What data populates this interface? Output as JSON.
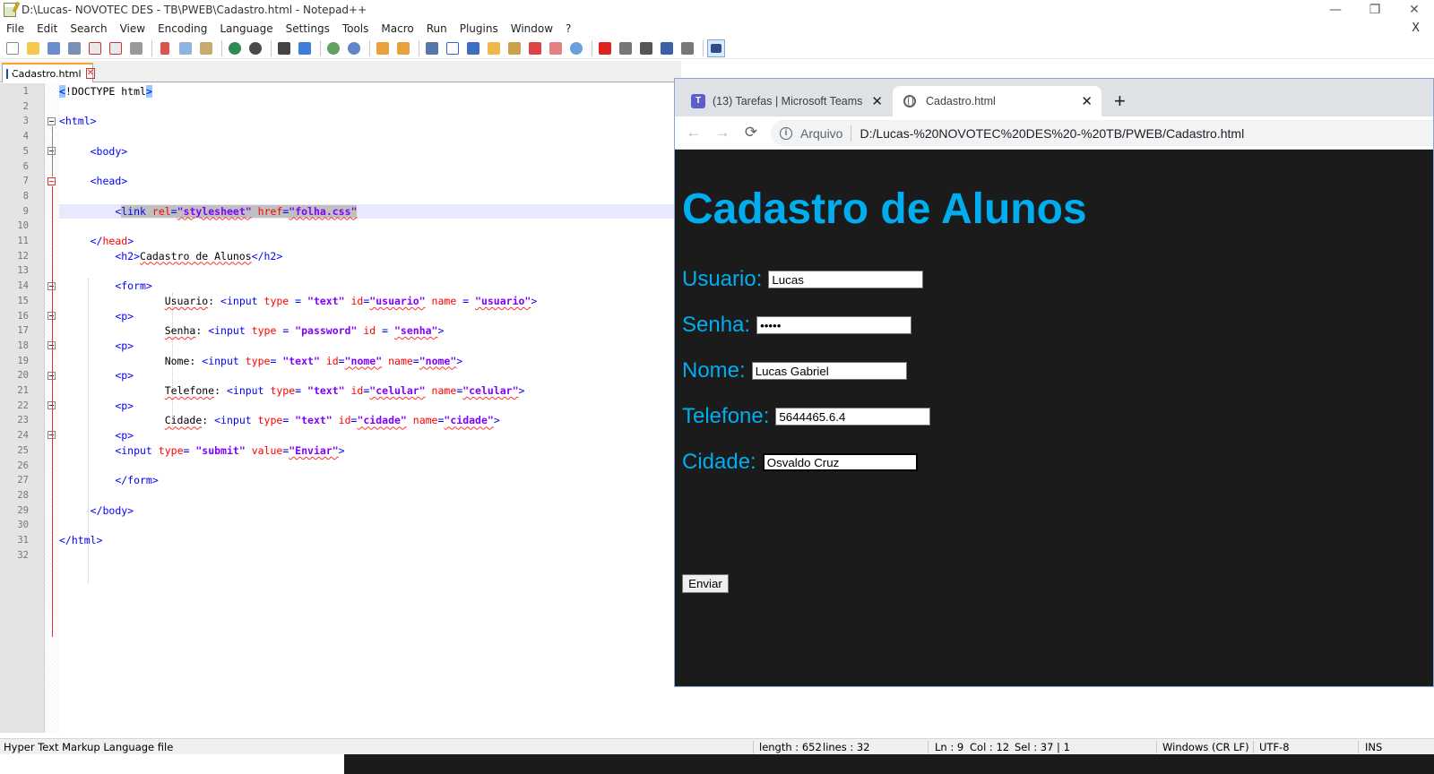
{
  "npp": {
    "title": "D:\\Lucas- NOVOTEC DES - TB\\PWEB\\Cadastro.html - Notepad++",
    "menu": [
      "File",
      "Edit",
      "Search",
      "View",
      "Encoding",
      "Language",
      "Settings",
      "Tools",
      "Macro",
      "Run",
      "Plugins",
      "Window",
      "?"
    ],
    "menu_close": "X",
    "window_controls": {
      "minimize": "—",
      "restore": "❐",
      "close": "✕"
    },
    "tab": {
      "label": "Cadastro.html",
      "close": "✕"
    },
    "line_numbers": [
      "1",
      "2",
      "3",
      "4",
      "5",
      "6",
      "7",
      "8",
      "9",
      "10",
      "11",
      "12",
      "13",
      "14",
      "15",
      "16",
      "17",
      "18",
      "19",
      "20",
      "21",
      "22",
      "23",
      "24",
      "25",
      "26",
      "27",
      "28",
      "29",
      "30",
      "31",
      "32"
    ],
    "status": {
      "file_type": "Hyper Text Markup Language file",
      "length": "length : 652",
      "lines": "lines : 32",
      "ln": "Ln : 9",
      "col": "Col : 12",
      "sel": "Sel : 37 | 1",
      "eol": "Windows (CR LF)",
      "encoding": "UTF-8",
      "mode": "INS"
    }
  },
  "browser": {
    "tabs": [
      {
        "label": "(13) Tarefas | Microsoft Teams",
        "icon": "teams-icon"
      },
      {
        "label": "Cadastro.html",
        "icon": "globe-icon"
      }
    ],
    "new_tab": "+",
    "scheme_label": "Arquivo",
    "url": "D:/Lucas-%20NOVOTEC%20DES%20-%20TB/PWEB/Cadastro.html",
    "page": {
      "heading": "Cadastro de Alunos",
      "fields": [
        {
          "label": "Usuario:",
          "value": "Lucas",
          "type": "text"
        },
        {
          "label": "Senha:",
          "value": "•••••",
          "type": "password"
        },
        {
          "label": "Nome:",
          "value": "Lucas Gabriel",
          "type": "text"
        },
        {
          "label": "Telefone:",
          "value": "5644465.6.4",
          "type": "text"
        },
        {
          "label": "Cidade:",
          "value": "Osvaldo Cruz",
          "type": "text"
        }
      ],
      "submit": "Enviar"
    },
    "colors": {
      "heading": "#00aeef",
      "background": "#1b1b1b"
    }
  },
  "code": {
    "l1_a": "<",
    "l1_b": "!DOCTYPE html",
    "l1_c": ">",
    "l3": "<html>",
    "l5": "<body>",
    "l7": "<head>",
    "l9_a": "<",
    "l9_b": "link",
    "l9_c": "rel",
    "l9_d": "=",
    "l9_e": "\"stylesheet\"",
    "l9_f": "href",
    "l9_g": "=",
    "l9_h": "\"folha.css\"",
    "l11_a": "</",
    "l11_b": "head",
    "l11_c": ">",
    "l12_a": "<h2>",
    "l12_b": "Cadastro de Alunos",
    "l12_c": "</h2>",
    "l14": "<form>",
    "l15_a": "Usuario",
    "l15_b": ":",
    "l15_c": "<input",
    "l15_d": "type",
    "l15_e": " = ",
    "l15_f": "\"text\"",
    "l15_g": "id",
    "l15_h": "=",
    "l15_i": "\"usuario\"",
    "l15_j": "name",
    "l15_k": " = ",
    "l15_l": "\"usuario\"",
    "l15_m": ">",
    "p": "<p>",
    "l17_a": "Senha",
    "l17_b": ":",
    "l17_c": "<input",
    "l17_d": "type",
    "l17_e": " = ",
    "l17_f": "\"password\"",
    "l17_g": "id",
    "l17_h": " = ",
    "l17_i": "\"senha\"",
    "l17_j": ">",
    "l19_a": "Nome",
    "l19_b": ":",
    "l19_c": "<input",
    "l19_d": "type",
    "l19_e": "= ",
    "l19_f": "\"text\"",
    "l19_g": "id",
    "l19_h": "=",
    "l19_i": "\"nome\"",
    "l19_j": "name",
    "l19_k": "=",
    "l19_l": "\"nome\"",
    "l19_m": ">",
    "l21_a": "Telefone",
    "l21_b": ":",
    "l21_c": "<input",
    "l21_d": "type",
    "l21_e": "= ",
    "l21_f": "\"text\"",
    "l21_g": "id",
    "l21_h": "=",
    "l21_i": "\"celular\"",
    "l21_j": "name",
    "l21_k": "=",
    "l21_l": "\"celular\"",
    "l21_m": ">",
    "l23_a": "Cidade",
    "l23_b": ":",
    "l23_c": "<input",
    "l23_d": "type",
    "l23_e": "= ",
    "l23_f": "\"text\"",
    "l23_g": "id",
    "l23_h": "=",
    "l23_i": "\"cidade\"",
    "l23_j": "name",
    "l23_k": "=",
    "l23_l": "\"cidade\"",
    "l23_m": ">",
    "l25_a": "<input",
    "l25_b": "type",
    "l25_c": "= ",
    "l25_d": "\"submit\"",
    "l25_e": "value",
    "l25_f": "=",
    "l25_g": "\"Enviar\"",
    "l25_h": ">",
    "l27": "</form>",
    "l29": "</body>",
    "l31": "</html>"
  }
}
